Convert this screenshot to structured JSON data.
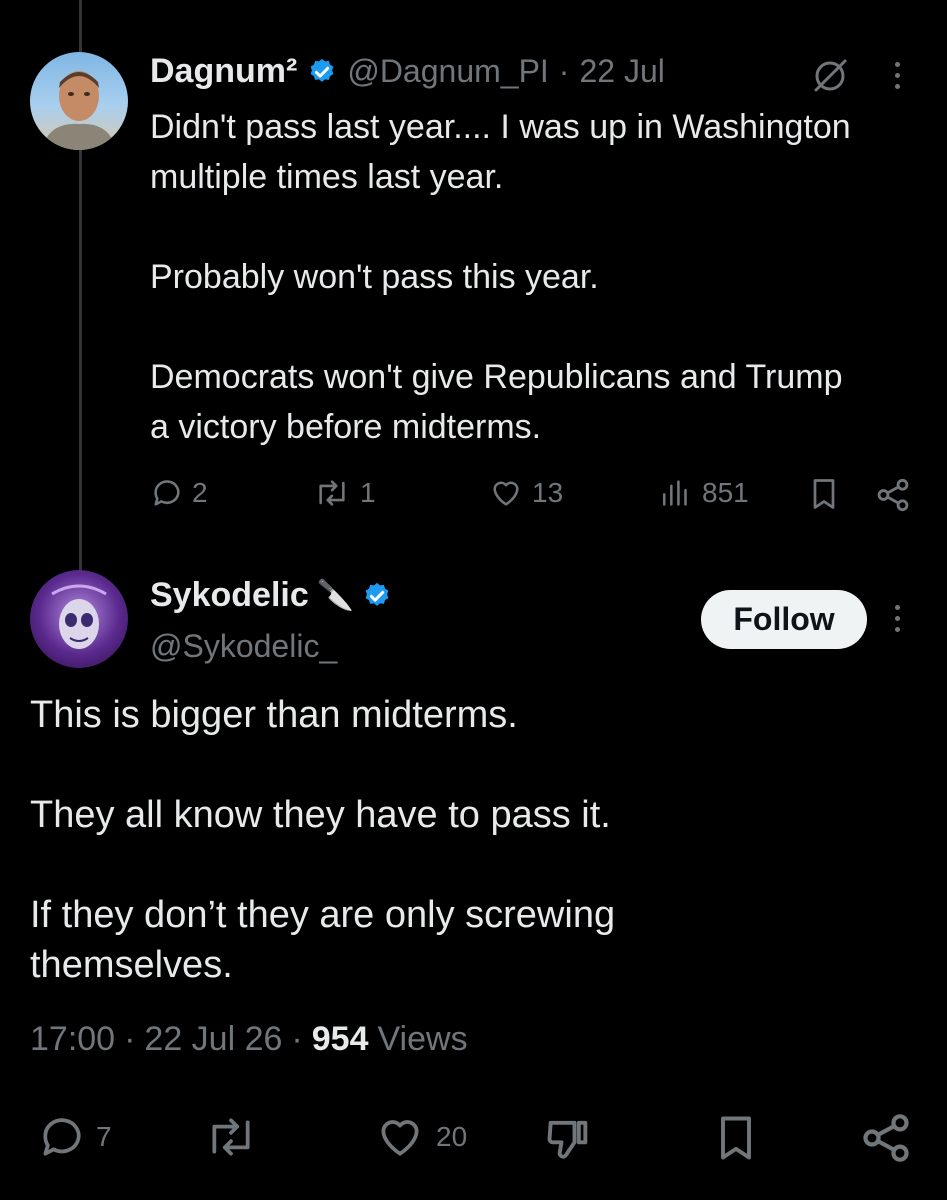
{
  "parent_tweet": {
    "display_name": "Dagnum²",
    "handle": "@Dagnum_PI",
    "separator": "·",
    "date": "22 Jul",
    "text": "Didn't pass last year.... I was up in Washington\nmultiple times last year.\n\nProbably won't pass this year.\n\nDemocrats won't give Republicans and Trump\na victory before midterms.",
    "replies": "2",
    "reposts": "1",
    "likes": "13",
    "views": "851",
    "icons": [
      "grok-icon",
      "more-icon",
      "reply-icon",
      "repost-icon",
      "like-icon",
      "views-icon",
      "bookmark-icon",
      "share-icon"
    ]
  },
  "main_tweet": {
    "display_name": "Sykodelic",
    "name_emoji": "🔪",
    "handle": "@Sykodelic_",
    "follow_label": "Follow",
    "text": "This is bigger than midterms.\n\nThey all know they have to pass it.\n\nIf they don’t they are only screwing\nthemselves.",
    "time": "17:00",
    "sep1": "·",
    "date": "22 Jul 26",
    "sep2": "·",
    "views_count": "954",
    "views_label": "Views",
    "replies": "7",
    "likes": "20",
    "icons": [
      "reply-icon",
      "repost-icon",
      "like-icon",
      "dislike-icon",
      "bookmark-icon",
      "share-icon"
    ]
  },
  "colors": {
    "background": "#000000",
    "text": "#e7e9ea",
    "muted": "#71767b",
    "verified_blue": "#1d9bf0",
    "follow_bg": "#eff3f4"
  }
}
